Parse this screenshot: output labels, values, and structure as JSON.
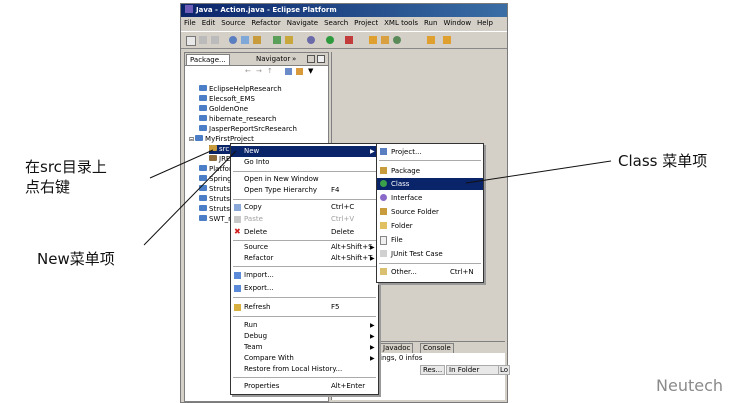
{
  "window": {
    "title": "Java - Action.java - Eclipse Platform",
    "menu": [
      "File",
      "Edit",
      "Source",
      "Refactor",
      "Navigate",
      "Search",
      "Project",
      "XML tools",
      "Run",
      "Window",
      "Help"
    ]
  },
  "left_pane": {
    "tabs": [
      "Package...",
      "Navigator"
    ],
    "overflow_label": "»",
    "tree": [
      "EclipseHelpResearch",
      "Elecsoft_EMS",
      "GoldenOne",
      "hibernate_research",
      "JasperReportSrcResearch",
      "MyFirstProject",
      "src",
      "JRE",
      "Platfor",
      "Spring",
      "Struts",
      "Struts",
      "Struts",
      "SWT_r"
    ]
  },
  "context_menu": {
    "items": [
      {
        "label": "New",
        "shortcut": "",
        "arrow": true
      },
      {
        "label": "Go Into",
        "shortcut": "",
        "arrow": false
      },
      {
        "label": "Open in New Window",
        "shortcut": "",
        "arrow": false
      },
      {
        "label": "Open Type Hierarchy",
        "shortcut": "F4",
        "arrow": false
      },
      {
        "label": "Copy",
        "shortcut": "Ctrl+C",
        "arrow": false
      },
      {
        "label": "Paste",
        "shortcut": "Ctrl+V",
        "arrow": false
      },
      {
        "label": "Delete",
        "shortcut": "Delete",
        "arrow": false
      },
      {
        "label": "Source",
        "shortcut": "Alt+Shift+S",
        "arrow": true
      },
      {
        "label": "Refactor",
        "shortcut": "Alt+Shift+T",
        "arrow": true
      },
      {
        "label": "Import...",
        "shortcut": "",
        "arrow": false
      },
      {
        "label": "Export...",
        "shortcut": "",
        "arrow": false
      },
      {
        "label": "Refresh",
        "shortcut": "F5",
        "arrow": false
      },
      {
        "label": "Run",
        "shortcut": "",
        "arrow": true
      },
      {
        "label": "Debug",
        "shortcut": "",
        "arrow": true
      },
      {
        "label": "Team",
        "shortcut": "",
        "arrow": true
      },
      {
        "label": "Compare With",
        "shortcut": "",
        "arrow": true
      },
      {
        "label": "Restore from Local History...",
        "shortcut": "",
        "arrow": false
      },
      {
        "label": "Properties",
        "shortcut": "Alt+Enter",
        "arrow": false
      }
    ]
  },
  "submenu": {
    "items": [
      {
        "label": "Project...",
        "shortcut": ""
      },
      {
        "label": "Package",
        "shortcut": ""
      },
      {
        "label": "Class",
        "shortcut": ""
      },
      {
        "label": "Interface",
        "shortcut": ""
      },
      {
        "label": "Source Folder",
        "shortcut": ""
      },
      {
        "label": "Folder",
        "shortcut": ""
      },
      {
        "label": "File",
        "shortcut": ""
      },
      {
        "label": "JUnit Test Case",
        "shortcut": ""
      },
      {
        "label": "Other...",
        "shortcut": "Ctrl+N"
      }
    ]
  },
  "bottom_panel": {
    "tabs": [
      "Javadoc",
      "Console"
    ],
    "status": "ings, 0 infos",
    "columns": [
      "Res...",
      "In Folder",
      "Lo"
    ]
  },
  "annotations": {
    "src_right_click": "在src目录上\n点右键",
    "new_item": "New菜单项",
    "class_item": "Class 菜单项"
  },
  "watermark": "Neutech",
  "colors": {
    "selection": "#0a246a",
    "titlebar": "#0a246a",
    "folder": "#4b7ec6"
  }
}
